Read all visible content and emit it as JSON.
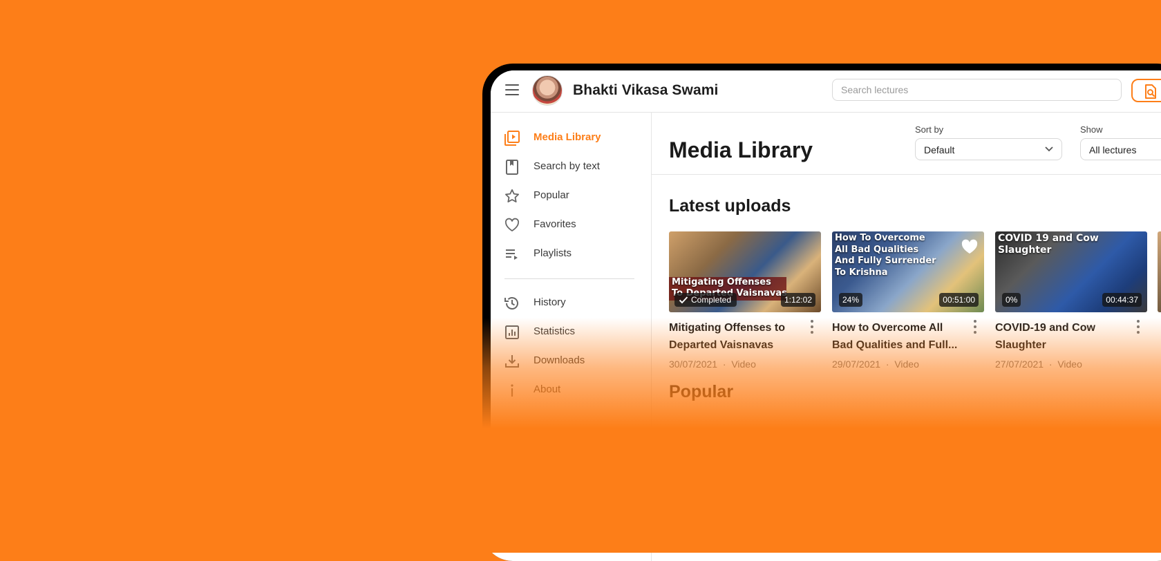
{
  "app": {
    "title": "Bhakti Vikasa Swami"
  },
  "search": {
    "placeholder": "Search lectures"
  },
  "sidebar": {
    "items": [
      {
        "label": "Media Library",
        "icon": "video-library-icon",
        "active": true
      },
      {
        "label": "Search by text",
        "icon": "book-icon"
      },
      {
        "label": "Popular",
        "icon": "star-icon"
      },
      {
        "label": "Favorites",
        "icon": "heart-icon"
      },
      {
        "label": "Playlists",
        "icon": "playlist-icon"
      },
      {
        "label": "History",
        "icon": "history-icon"
      },
      {
        "label": "Statistics",
        "icon": "statistics-icon"
      },
      {
        "label": "Downloads",
        "icon": "download-icon"
      },
      {
        "label": "About",
        "icon": "info-icon"
      }
    ]
  },
  "main": {
    "page_title": "Media Library",
    "sort": {
      "label": "Sort by",
      "value": "Default"
    },
    "show": {
      "label": "Show",
      "value": "All lectures"
    },
    "latest_title": "Latest uploads",
    "popular_title": "Popular"
  },
  "cards": [
    {
      "thumb_text": "Mitigating Offenses\nTo Departed Vaisnavas",
      "badge": "Completed",
      "duration": "1:12:02",
      "title": "Mitigating Offenses to\nDeparted Vaisnavas",
      "date": "30/07/2021",
      "type": "Video"
    },
    {
      "thumb_text": "How To Overcome\nAll Bad Qualities\nAnd Fully Surrender\nTo Krishna",
      "progress": "24%",
      "duration": "00:51:00",
      "title": "How to Overcome All\nBad Qualities and Full...",
      "date": "29/07/2021",
      "type": "Video"
    },
    {
      "thumb_text": "COVID 19 and Cow Slaughter",
      "progress": "0%",
      "duration": "00:44:37",
      "title": "COVID-19 and Cow\nSlaughter",
      "date": "27/07/2021",
      "type": "Video"
    }
  ],
  "colors": {
    "accent": "#FD7E18",
    "background": "#FD7E18",
    "text": "#1E1E1E"
  }
}
